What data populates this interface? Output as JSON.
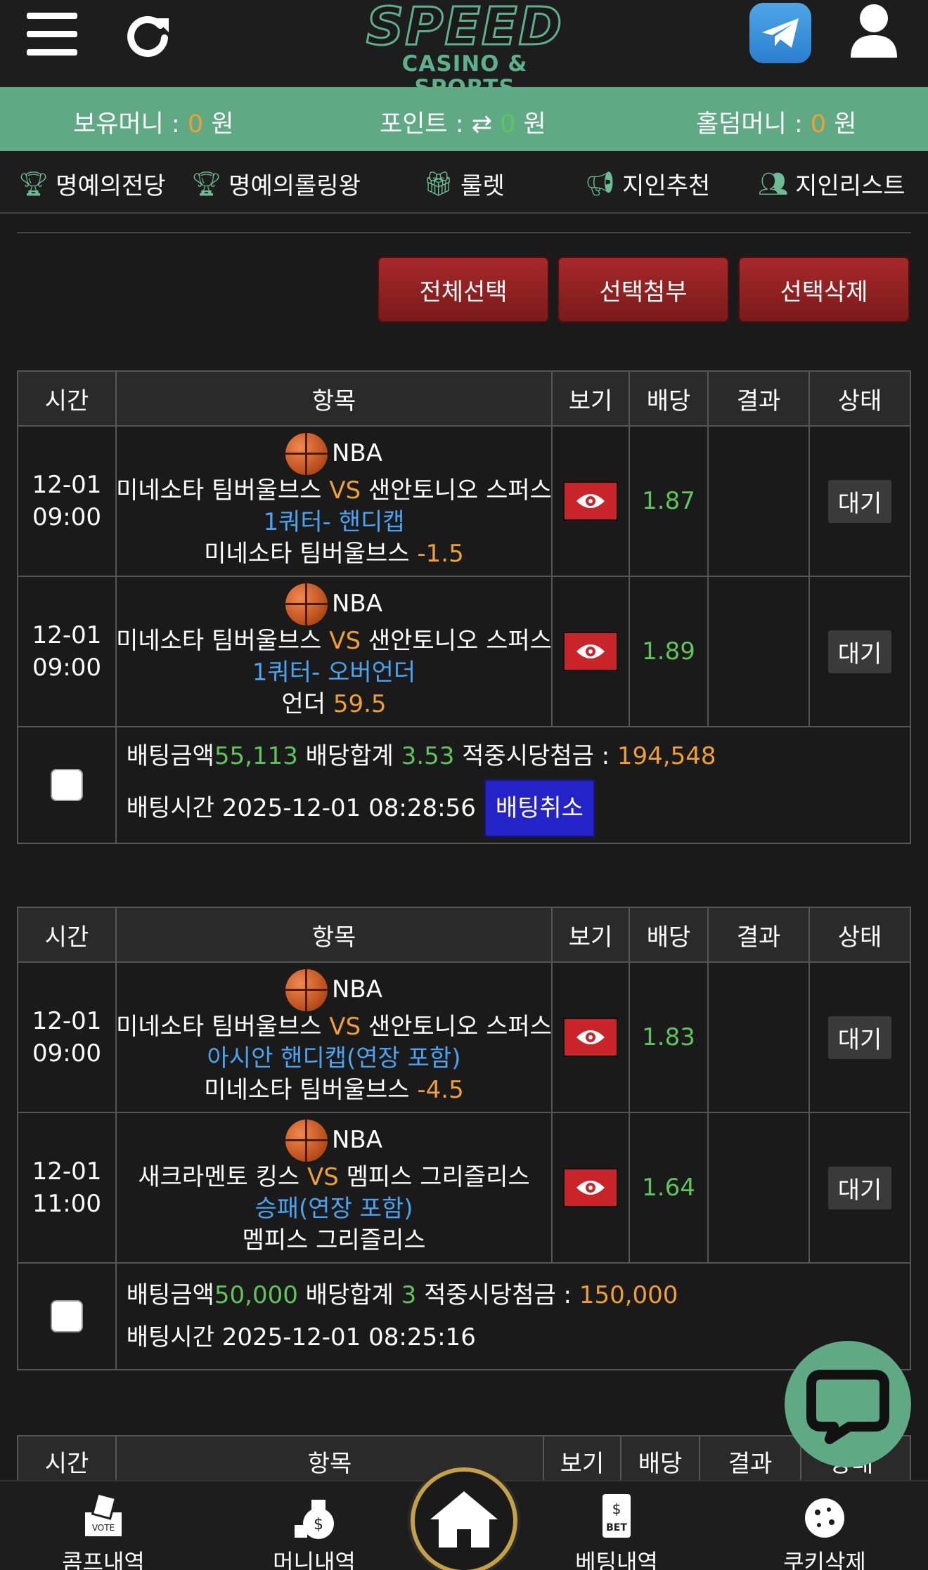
{
  "header": {
    "logo_main": "SPEED",
    "logo_sub": "CASINO & SPORTS"
  },
  "money_bar": {
    "holding_label": "보유머니 : ",
    "holding_value": "0",
    "holding_unit": " 원",
    "point_label": "포인트 : ",
    "point_value": "0",
    "point_unit": " 원",
    "holdem_label": "홀덤머니 : ",
    "holdem_value": "0",
    "holdem_unit": " 원"
  },
  "nav": {
    "hall_of_fame": "명예의전당",
    "rolling_king": "명예의롤링왕",
    "roulette": "룰렛",
    "referral": "지인추천",
    "referral_list": "지인리스트"
  },
  "actions": {
    "select_all": "전체선택",
    "attach_selected": "선택첨부",
    "delete_selected": "선택삭제"
  },
  "table_headers": {
    "time": "시간",
    "item": "항목",
    "view": "보기",
    "odds": "배당",
    "result": "결과",
    "status": "상태"
  },
  "bets": [
    {
      "games": [
        {
          "date": "12-01",
          "time": "09:00",
          "league": "NBA",
          "home": "미네소타 팀버울브스 ",
          "vs": "VS",
          "away": " 샌안토니오 스퍼스",
          "market": "1쿼터- 핸디캡",
          "pick": "미네소타 팀버울브스 ",
          "pick_value": "-1.5",
          "odds": "1.87",
          "status": "대기"
        },
        {
          "date": "12-01",
          "time": "09:00",
          "league": "NBA",
          "home": "미네소타 팀버울브스 ",
          "vs": "VS",
          "away": " 샌안토니오 스퍼스",
          "market": "1쿼터- 오버언더",
          "pick": "언더 ",
          "pick_value": "59.5",
          "odds": "1.89",
          "status": "대기"
        }
      ],
      "amount_label": "배팅금액 ",
      "amount": "55,113",
      "total_odds_label": " 배당합계 ",
      "total_odds": "3.53",
      "payout_label": " 적중시당첨금 : ",
      "payout": "194,548",
      "time_label": "배팅시간 ",
      "bet_time": "2025-12-01 08:28:56",
      "cancel_label": "배팅취소"
    },
    {
      "games": [
        {
          "date": "12-01",
          "time": "09:00",
          "league": "NBA",
          "home": "미네소타 팀버울브스 ",
          "vs": "VS",
          "away": " 샌안토니오 스퍼스",
          "market": "아시안 핸디캡(연장 포함)",
          "pick": "미네소타 팀버울브스 ",
          "pick_value": "-4.5",
          "odds": "1.83",
          "status": "대기"
        },
        {
          "date": "12-01",
          "time": "11:00",
          "league": "NBA",
          "home": "새크라멘토 킹스 ",
          "vs": "VS",
          "away": " 멤피스 그리즐리스",
          "market": "승패(연장 포함)",
          "pick": "멤피스 그리즐리스",
          "pick_value": "",
          "odds": "1.64",
          "status": "대기"
        }
      ],
      "amount_label": "배팅금액 ",
      "amount": "50,000",
      "total_odds_label": " 배당합계 ",
      "total_odds": "3",
      "payout_label": " 적중시당첨금 : ",
      "payout": "150,000",
      "time_label": "배팅시간 ",
      "bet_time": "2025-12-01 08:25:16"
    }
  ],
  "bottom_nav": {
    "comp": "콤프내역",
    "money": "머니내역",
    "betting": "베팅내역",
    "cookie": "쿠키삭제"
  }
}
